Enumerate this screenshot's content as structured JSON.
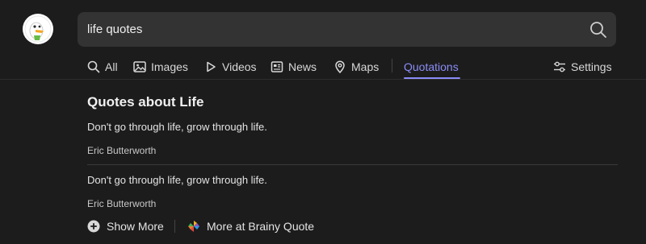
{
  "search": {
    "query": "life quotes"
  },
  "tabs": [
    {
      "label": "All",
      "icon": "search-icon"
    },
    {
      "label": "Images",
      "icon": "image-icon"
    },
    {
      "label": "Videos",
      "icon": "play-icon"
    },
    {
      "label": "News",
      "icon": "newspaper-icon"
    },
    {
      "label": "Maps",
      "icon": "map-pin-icon"
    },
    {
      "label": "Quotations",
      "active": true
    },
    {
      "label": "Settings",
      "icon": "sliders-icon"
    }
  ],
  "colors": {
    "background": "#1c1c1c",
    "search_bg": "#333333",
    "accent": "#8b8cf7"
  },
  "quotes_panel": {
    "heading": "Quotes about Life",
    "items": [
      {
        "text": "Don't go through life, grow through life.",
        "author": "Eric Butterworth"
      },
      {
        "text": "Don't go through life, grow through life.",
        "author": "Eric Butterworth"
      }
    ],
    "show_more_label": "Show More",
    "source_link_label": "More at Brainy Quote"
  }
}
